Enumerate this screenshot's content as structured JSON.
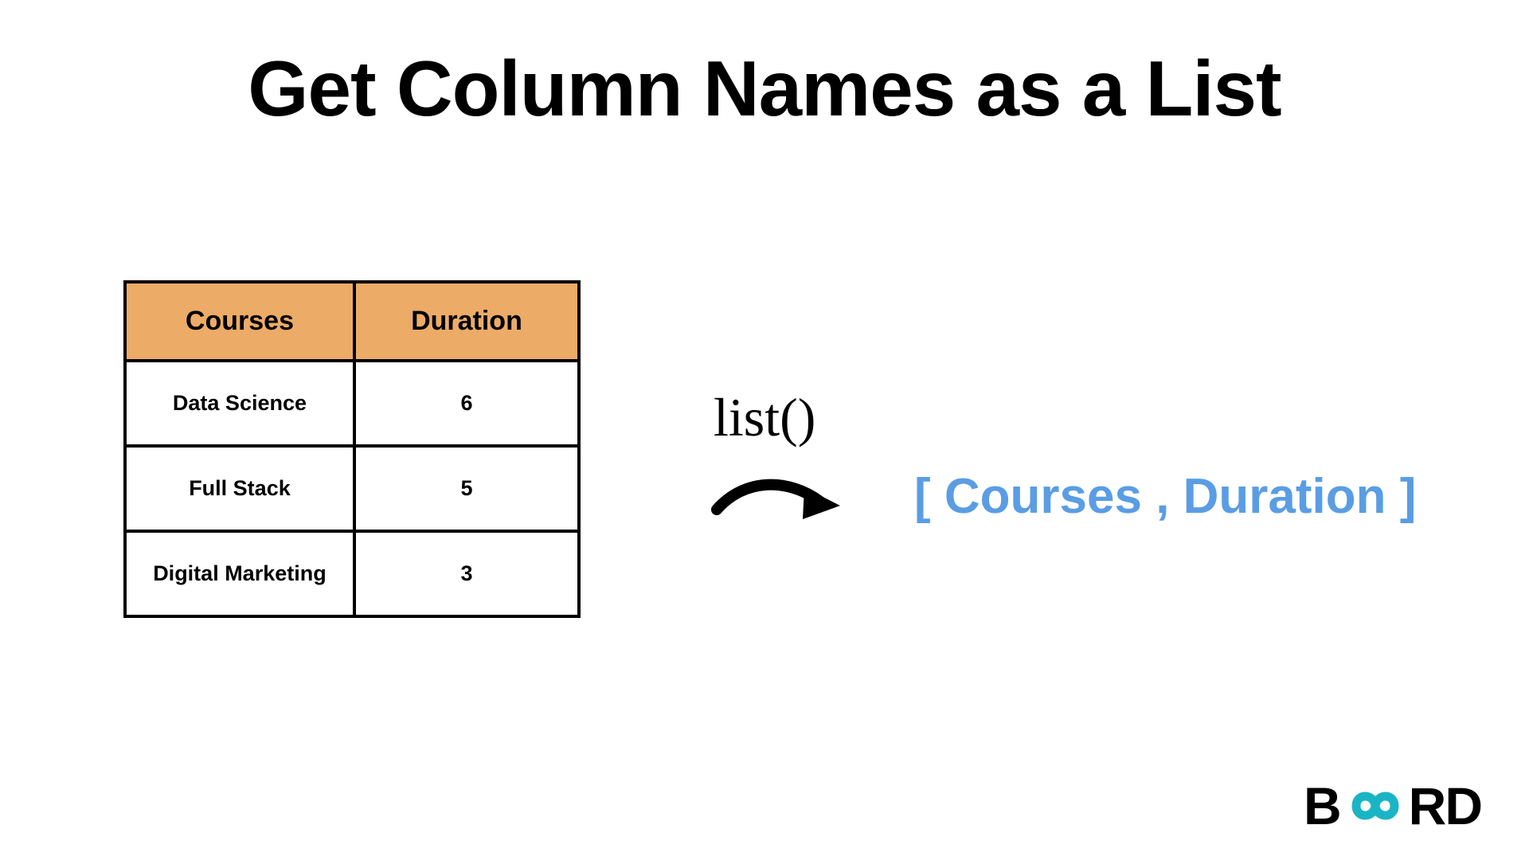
{
  "title": "Get Column Names as a List",
  "table": {
    "headers": [
      "Courses",
      "Duration"
    ],
    "rows": [
      {
        "course": "Data Science",
        "duration": "6"
      },
      {
        "course": "Full Stack",
        "duration": "5"
      },
      {
        "course": "Digital Marketing",
        "duration": "3"
      }
    ]
  },
  "function_label": "list()",
  "result_text": "[ Courses , Duration ]",
  "logo": {
    "left": "B",
    "right": "RD"
  },
  "colors": {
    "header_bg": "#ecab67",
    "result_text": "#5a9de4",
    "infinity_stroke": "#1ab5c5"
  }
}
